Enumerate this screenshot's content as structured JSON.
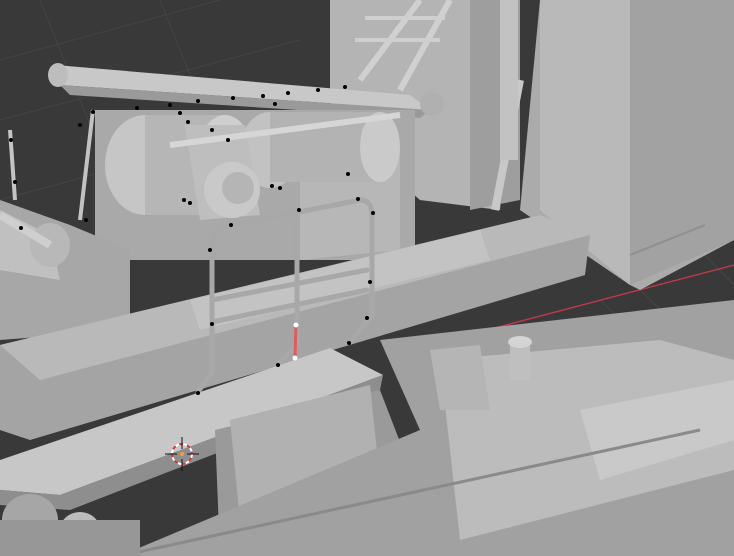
{
  "editor": {
    "type": "3D Viewport",
    "mode": "Edit Mode",
    "shading": "Solid"
  },
  "colors": {
    "background": "#393939",
    "grid_line": "#454545",
    "x_axis": "#c0394b",
    "mesh_light": "#bdbdbd",
    "mesh_mid": "#a3a3a3",
    "mesh_dark": "#8c8c8c",
    "selected_edge": "#e35a5a",
    "vertex": "#000000",
    "selected_vertex": "#ffffff",
    "cursor_red": "#d23a3a",
    "cursor_white": "#ffffff"
  },
  "icons": {
    "cursor": "3d-cursor-icon"
  }
}
